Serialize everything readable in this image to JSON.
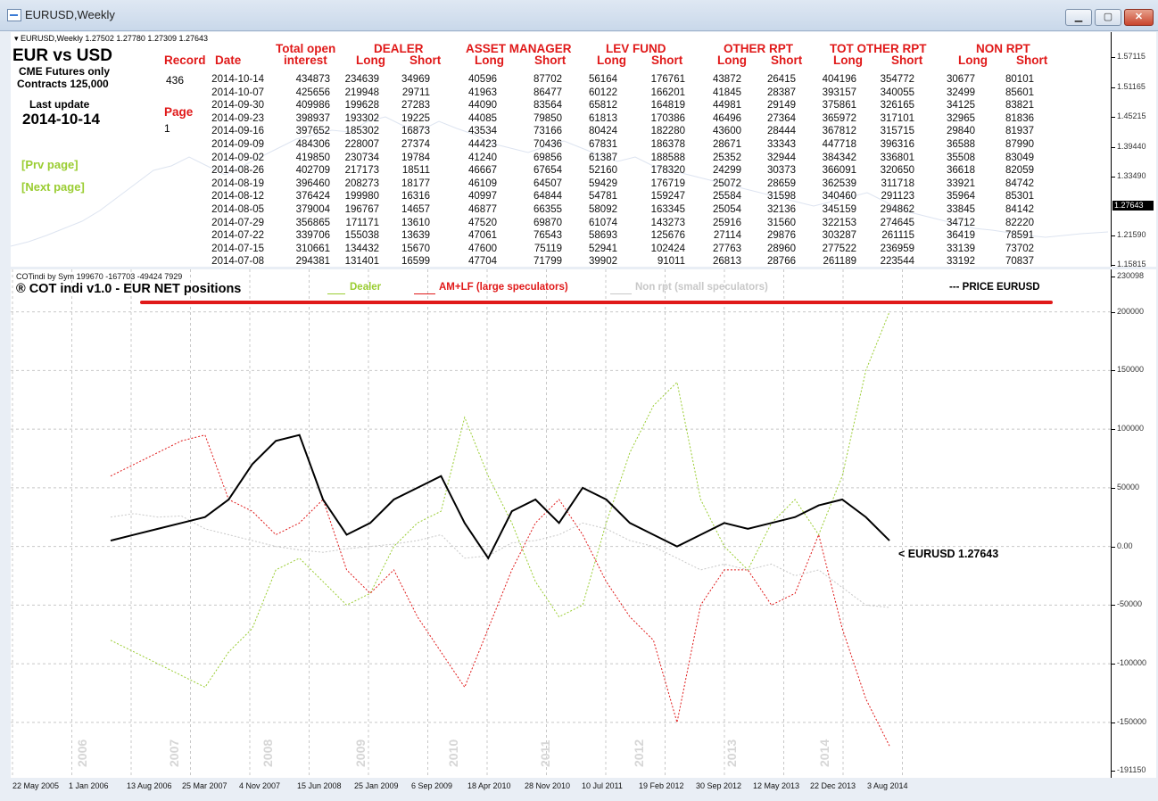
{
  "window": {
    "title": "EURUSD,Weekly",
    "min": "▁",
    "max": "▢",
    "close": "✕"
  },
  "colors": {
    "dealer": "#9acd32",
    "amlf": "#e01919",
    "nonrpt": "#c8c8c8",
    "price": "#000000"
  },
  "top_pane": {
    "info": "▾ EURUSD,Weekly  1.27502 1.27780 1.27309 1.27643",
    "pair": "EUR vs USD",
    "cme": "CME Futures only",
    "contracts": "Contracts 125,000",
    "last_update_label": "Last update",
    "last_update": "2014-10-14",
    "record_label": "Record",
    "record": "436",
    "date_label": "Date",
    "page_label": "Page",
    "page": "1",
    "prev": "[Prv page]",
    "next": "[Next page]",
    "groups": [
      "Total open",
      "DEALER",
      "ASSET MANAGER",
      "LEV FUND",
      "OTHER RPT",
      "TOT OTHER RPT",
      "NON RPT"
    ],
    "subheads": [
      "interest",
      "Long",
      "Short",
      "Long",
      "Short",
      "Long",
      "Short",
      "Long",
      "Short",
      "Long",
      "Short",
      "Long",
      "Short"
    ],
    "dates": [
      "2014-10-14",
      "2014-10-07",
      "2014-09-30",
      "2014-09-23",
      "2014-09-16",
      "2014-09-09",
      "2014-09-02",
      "2014-08-26",
      "2014-08-19",
      "2014-08-12",
      "2014-08-05",
      "2014-07-29",
      "2014-07-22",
      "2014-07-15",
      "2014-07-08"
    ],
    "columns": [
      [
        "434873",
        "425656",
        "409986",
        "398937",
        "397652",
        "484306",
        "419850",
        "402709",
        "396460",
        "376424",
        "379004",
        "356865",
        "339706",
        "310661",
        "294381"
      ],
      [
        "234639",
        "219948",
        "199628",
        "193302",
        "185302",
        "228007",
        "230734",
        "217173",
        "208273",
        "199980",
        "196767",
        "171171",
        "155038",
        "134432",
        "131401"
      ],
      [
        "34969",
        "29711",
        "27283",
        "19225",
        "16873",
        "27374",
        "19784",
        "18511",
        "18177",
        "16316",
        "14657",
        "13610",
        "13639",
        "15670",
        "16599"
      ],
      [
        "40596",
        "41963",
        "44090",
        "44085",
        "43534",
        "44423",
        "41240",
        "46667",
        "46109",
        "40997",
        "46877",
        "47520",
        "47061",
        "47600",
        "47704"
      ],
      [
        "87702",
        "86477",
        "83564",
        "79850",
        "73166",
        "70436",
        "69856",
        "67654",
        "64507",
        "64844",
        "66355",
        "69870",
        "76543",
        "75119",
        "71799"
      ],
      [
        "56164",
        "60122",
        "65812",
        "61813",
        "80424",
        "67831",
        "61387",
        "52160",
        "59429",
        "54781",
        "58092",
        "61074",
        "58693",
        "52941",
        "39902"
      ],
      [
        "176761",
        "166201",
        "164819",
        "170386",
        "182280",
        "186378",
        "188588",
        "178320",
        "176719",
        "159247",
        "163345",
        "143273",
        "125676",
        "102424",
        "91011"
      ],
      [
        "43872",
        "41845",
        "44981",
        "46496",
        "43600",
        "28671",
        "25352",
        "24299",
        "25072",
        "25584",
        "25054",
        "25916",
        "27114",
        "27763",
        "26813"
      ],
      [
        "26415",
        "28387",
        "29149",
        "27364",
        "28444",
        "33343",
        "32944",
        "30373",
        "28659",
        "31598",
        "32136",
        "31560",
        "29876",
        "28960",
        "28766"
      ],
      [
        "404196",
        "393157",
        "375861",
        "365972",
        "367812",
        "447718",
        "384342",
        "366091",
        "362539",
        "340460",
        "345159",
        "322153",
        "303287",
        "277522",
        "261189"
      ],
      [
        "354772",
        "340055",
        "326165",
        "317101",
        "315715",
        "396316",
        "336801",
        "320650",
        "311718",
        "291123",
        "294862",
        "274645",
        "261115",
        "236959",
        "223544"
      ],
      [
        "30677",
        "32499",
        "34125",
        "32965",
        "29840",
        "36588",
        "35508",
        "36618",
        "33921",
        "35964",
        "33845",
        "34712",
        "36419",
        "33139",
        "33192"
      ],
      [
        "80101",
        "85601",
        "83821",
        "81836",
        "81937",
        "87990",
        "83049",
        "82059",
        "84742",
        "85301",
        "84142",
        "82220",
        "78591",
        "73702",
        "70837"
      ]
    ],
    "price_scale": [
      "1.57115",
      "1.51165",
      "1.45215",
      "1.39440",
      "1.33490",
      "1.27643",
      "1.21590",
      "1.15815"
    ]
  },
  "bottom_pane": {
    "info": "COTindi by Sym 199670 -167703 -49424 7929",
    "title": "® COT indi v1.0 - EUR  NET positions",
    "legend": {
      "dealer": "Dealer",
      "amlf": "AM+LF (large speculators)",
      "nonrpt": "Non rpt (small speculators)",
      "price": "--- PRICE EURUSD"
    },
    "price_label": "< EURUSD  1.27643"
  },
  "chart_data": {
    "type": "line",
    "title": "® COT indi v1.0 - EUR  NET positions",
    "xlabel": "",
    "ylabel": "",
    "ylim": [
      -191150,
      230098
    ],
    "y_ticks": [
      "230098",
      "200000",
      "150000",
      "100000",
      "50000",
      "0.00",
      "-50000",
      "-100000",
      "-150000",
      "-191150"
    ],
    "x_ticks": [
      "22 May 2005",
      "1 Jan 2006",
      "13 Aug 2006",
      "25 Mar 2007",
      "4 Nov 2007",
      "15 Jun 2008",
      "25 Jan 2009",
      "6 Sep 2009",
      "18 Apr 2010",
      "28 Nov 2010",
      "10 Jul 2011",
      "19 Feb 2012",
      "30 Sep 2012",
      "12 May 2013",
      "22 Dec 2013",
      "3 Aug 2014"
    ],
    "year_labels": [
      "2006",
      "2007",
      "2008",
      "2009",
      "2010",
      "2011",
      "2012",
      "2013",
      "2014"
    ],
    "dates": [
      "2006-06",
      "2006-09",
      "2006-12",
      "2007-03",
      "2007-06",
      "2007-09",
      "2007-12",
      "2008-03",
      "2008-06",
      "2008-09",
      "2008-12",
      "2009-03",
      "2009-06",
      "2009-09",
      "2009-12",
      "2010-03",
      "2010-06",
      "2010-09",
      "2010-12",
      "2011-03",
      "2011-06",
      "2011-09",
      "2011-12",
      "2012-03",
      "2012-06",
      "2012-09",
      "2012-12",
      "2013-03",
      "2013-06",
      "2013-09",
      "2013-12",
      "2014-03",
      "2014-06",
      "2014-10"
    ],
    "series": [
      {
        "name": "Dealer",
        "values": [
          -80000,
          -90000,
          -100000,
          -110000,
          -120000,
          -90000,
          -70000,
          -20000,
          -10000,
          -30000,
          -50000,
          -40000,
          0,
          20000,
          30000,
          110000,
          60000,
          20000,
          -30000,
          -60000,
          -50000,
          20000,
          80000,
          120000,
          140000,
          40000,
          0,
          -20000,
          20000,
          40000,
          10000,
          60000,
          150000,
          200000
        ]
      },
      {
        "name": "AM+LF (large speculators)",
        "values": [
          60000,
          70000,
          80000,
          90000,
          95000,
          40000,
          30000,
          10000,
          20000,
          40000,
          -20000,
          -40000,
          -20000,
          -60000,
          -90000,
          -120000,
          -70000,
          -20000,
          20000,
          40000,
          10000,
          -30000,
          -60000,
          -80000,
          -150000,
          -50000,
          -20000,
          -20000,
          -50000,
          -40000,
          10000,
          -70000,
          -130000,
          -170000
        ]
      },
      {
        "name": "Non rpt (small speculators)",
        "values": [
          25000,
          28000,
          25000,
          26000,
          15000,
          10000,
          5000,
          0,
          -3000,
          -5000,
          -2000,
          0,
          2000,
          5000,
          10000,
          -10000,
          -8000,
          3000,
          5000,
          10000,
          20000,
          15000,
          5000,
          0,
          -10000,
          -20000,
          -15000,
          -20000,
          -15000,
          -25000,
          -20000,
          -35000,
          -50000,
          -52000
        ]
      },
      {
        "name": "PRICE EURUSD",
        "values": [
          5000,
          10000,
          15000,
          20000,
          25000,
          40000,
          70000,
          90000,
          95000,
          40000,
          10000,
          20000,
          40000,
          50000,
          60000,
          20000,
          -10000,
          30000,
          40000,
          20000,
          50000,
          40000,
          20000,
          10000,
          0,
          10000,
          20000,
          15000,
          20000,
          25000,
          35000,
          40000,
          25000,
          5000
        ]
      }
    ]
  }
}
